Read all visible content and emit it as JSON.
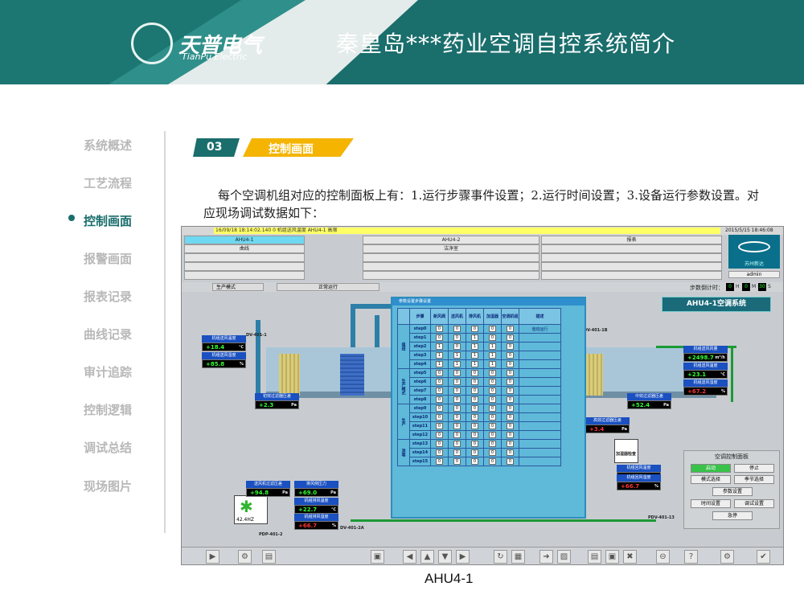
{
  "header": {
    "title": "秦皇岛***药业空调自控系统简介",
    "logo_cn": "天普电气",
    "logo_en": "TianPu Electric"
  },
  "sidebar": {
    "items": [
      {
        "label": "系统概述"
      },
      {
        "label": "工艺流程"
      },
      {
        "label": "控制画面"
      },
      {
        "label": "报警画面"
      },
      {
        "label": "报表记录"
      },
      {
        "label": "曲线记录"
      },
      {
        "label": "审计追踪"
      },
      {
        "label": "控制逻辑"
      },
      {
        "label": "调试总结"
      },
      {
        "label": "现场图片"
      }
    ],
    "active_index": 2
  },
  "section": {
    "number": "03",
    "title": "控制画面",
    "paragraph": "每个空调机组对应的控制面板上有：1.运行步骤事件设置；2.运行时间设置；3.设备运行参数设置。对应现场调试数据如下："
  },
  "scada": {
    "alarm_text": "16/09/18 18:14:02.140 0  机组送风温度 AHU4-1 高限",
    "datetime": "2015/5/15 18:46:08",
    "nav_buttons": [
      {
        "label": "AHU4-1",
        "selected": true
      },
      {
        "label": "AHU4-2",
        "selected": false
      },
      {
        "label": "报表",
        "selected": false
      },
      {
        "label": "曲线",
        "selected": false
      },
      {
        "label": "洁净室",
        "selected": false
      },
      {
        "label": "",
        "selected": false
      }
    ],
    "logo_text": "苏州新达",
    "user": "admin",
    "mode_label": "生产模式",
    "run_status": "正常运行",
    "countdown_label": "步数倒计时：",
    "countdown": {
      "h": "0",
      "m": "0",
      "s": "30"
    },
    "unit_title": "AHU4-1空调系统",
    "readouts": [
      {
        "label": "机组送风温度",
        "value": "+18.4",
        "unit": "℃",
        "red": false
      },
      {
        "label": "机组送风湿度",
        "value": "+85.8",
        "unit": "%",
        "red": false
      },
      {
        "label": "初效过滤器压差",
        "value": "+2.3",
        "unit": "Pa",
        "red": false
      },
      {
        "label": "机组送风风量",
        "value": "+2498.7",
        "unit": "m³/h",
        "red": false
      },
      {
        "label": "机组送风温度",
        "value": "+23.1",
        "unit": "℃",
        "red": false
      },
      {
        "label": "机组送风湿度",
        "value": "+67.2",
        "unit": "%",
        "red": true
      },
      {
        "label": "中效过滤器压差",
        "value": "+52.4",
        "unit": "Pa",
        "red": false
      },
      {
        "label": "高效过滤器压差",
        "value": "+3.4",
        "unit": "Pa",
        "red": true
      },
      {
        "label": "机组回风温度",
        "value": "+22.8",
        "unit": "℃",
        "red": false
      },
      {
        "label": "机组回风湿度",
        "value": "+66.7",
        "unit": "%",
        "red": true
      },
      {
        "label": "送风机过滤压差",
        "value": "+94.8",
        "unit": "Pa",
        "red": false
      },
      {
        "label": "排风侧压力",
        "value": "+69.0",
        "unit": "Pa",
        "red": false
      },
      {
        "label": "机组排风温度",
        "value": "+22.7",
        "unit": "℃",
        "red": false
      },
      {
        "label": "机组排风湿度",
        "value": "+66.7",
        "unit": "%",
        "red": true
      }
    ],
    "vfd_freq": "42.4HZ",
    "tags": [
      "DV-401-1",
      "DV-401-2A",
      "PDP-401-2",
      "PDV-401-14",
      "PDV-401-13",
      "DV-401-1B",
      "加湿器检查"
    ],
    "dialog": {
      "title": "参数设置步骤设置",
      "headers": [
        "步骤",
        "新风阀",
        "送风机",
        "排风机",
        "加湿器",
        "空调机组",
        "描述"
      ],
      "first_desc": "值班运行",
      "groups": [
        "值班",
        "生产模式",
        "生产",
        "消毒"
      ],
      "steps": [
        {
          "name": "step0",
          "vals": [
            "0",
            "0",
            "0",
            "0",
            "0"
          ]
        },
        {
          "name": "step1",
          "vals": [
            "0",
            "0",
            "1",
            "0",
            "0"
          ]
        },
        {
          "name": "step2",
          "vals": [
            "1",
            "0",
            "1",
            "1",
            "0"
          ]
        },
        {
          "name": "step3",
          "vals": [
            "1",
            "1",
            "1",
            "1",
            "0"
          ]
        },
        {
          "name": "step4",
          "vals": [
            "1",
            "1",
            "1",
            "1",
            "0"
          ]
        },
        {
          "name": "step5",
          "vals": [
            "0",
            "0",
            "0",
            "0",
            "0"
          ]
        },
        {
          "name": "step6",
          "vals": [
            "0",
            "0",
            "0",
            "0",
            "0"
          ]
        },
        {
          "name": "step7",
          "vals": [
            "0",
            "0",
            "0",
            "0",
            "0"
          ]
        },
        {
          "name": "step8",
          "vals": [
            "0",
            "0",
            "0",
            "0",
            "0"
          ]
        },
        {
          "name": "step9",
          "vals": [
            "0",
            "0",
            "0",
            "0",
            "0"
          ]
        },
        {
          "name": "step10",
          "vals": [
            "0",
            "0",
            "0",
            "0",
            "0"
          ]
        },
        {
          "name": "step11",
          "vals": [
            "0",
            "0",
            "0",
            "0",
            "0"
          ]
        },
        {
          "name": "step12",
          "vals": [
            "0",
            "0",
            "0",
            "0",
            "0"
          ]
        },
        {
          "name": "step13",
          "vals": [
            "0",
            "0",
            "0",
            "0",
            "0"
          ]
        },
        {
          "name": "step14",
          "vals": [
            "0",
            "0",
            "0",
            "0",
            "0"
          ]
        },
        {
          "name": "step15",
          "vals": [
            "0",
            "0",
            "0",
            "0",
            "0"
          ]
        }
      ]
    },
    "control_panel": {
      "title": "空调控制面板",
      "buttons": [
        "启动",
        "停止",
        "模式选择",
        "季节选择",
        "参数设置",
        "时间设置",
        "调试设置",
        "急停"
      ]
    }
  },
  "caption": "AHU4-1"
}
